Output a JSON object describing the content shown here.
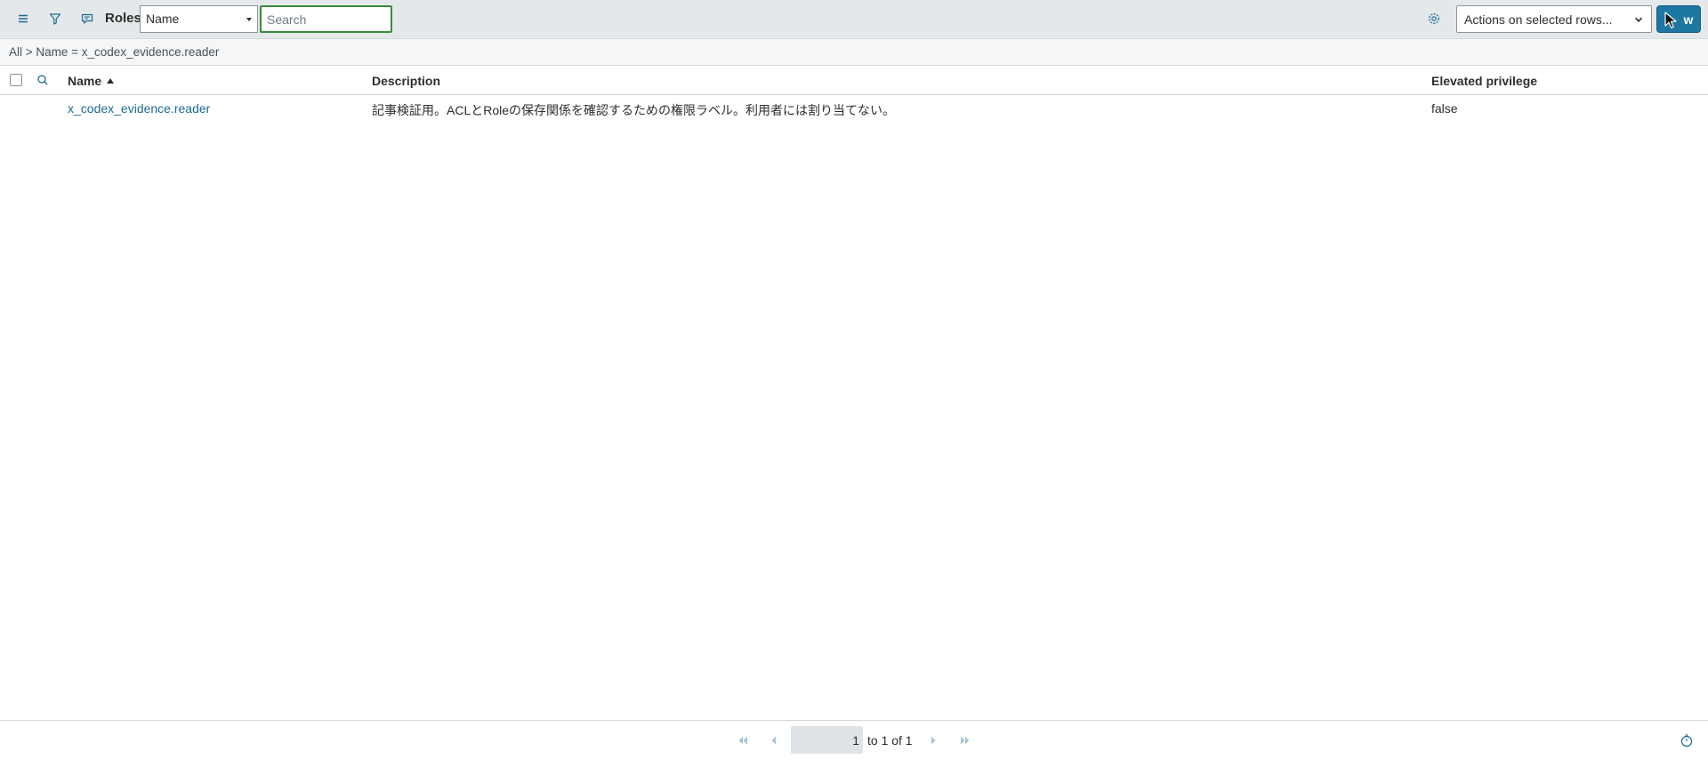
{
  "toolbar": {
    "title": "Roles",
    "field_select_value": "Name",
    "search_placeholder": "Search",
    "actions_select_value": "Actions on selected rows...",
    "new_label": "New",
    "new_label_visible": "w",
    "icons": [
      "menu-icon",
      "filter-icon",
      "chat-icon",
      "gear-icon",
      "chevron-down-icon"
    ],
    "accent_color": "#1d77a3",
    "search_border_color": "#3b8a3b"
  },
  "breadcrumb": {
    "text": "All > Name = x_codex_evidence.reader"
  },
  "table": {
    "columns": [
      {
        "label": "Name",
        "sorted": "ascending"
      },
      {
        "label": "Description"
      },
      {
        "label": "Elevated privilege"
      }
    ],
    "rows": [
      {
        "name": "x_codex_evidence.reader",
        "description": "記事検証用。ACLとRoleの保存関係を確認するための権限ラベル。利用者には割り当てない。",
        "elevated_privilege": "false"
      }
    ],
    "link_color": "#1d6b91"
  },
  "pagination": {
    "current_page": "1",
    "summary": "to 1 of 1",
    "icons": [
      "first-page-icon",
      "previous-page-icon",
      "next-page-icon",
      "last-page-icon",
      "timer-icon"
    ]
  }
}
